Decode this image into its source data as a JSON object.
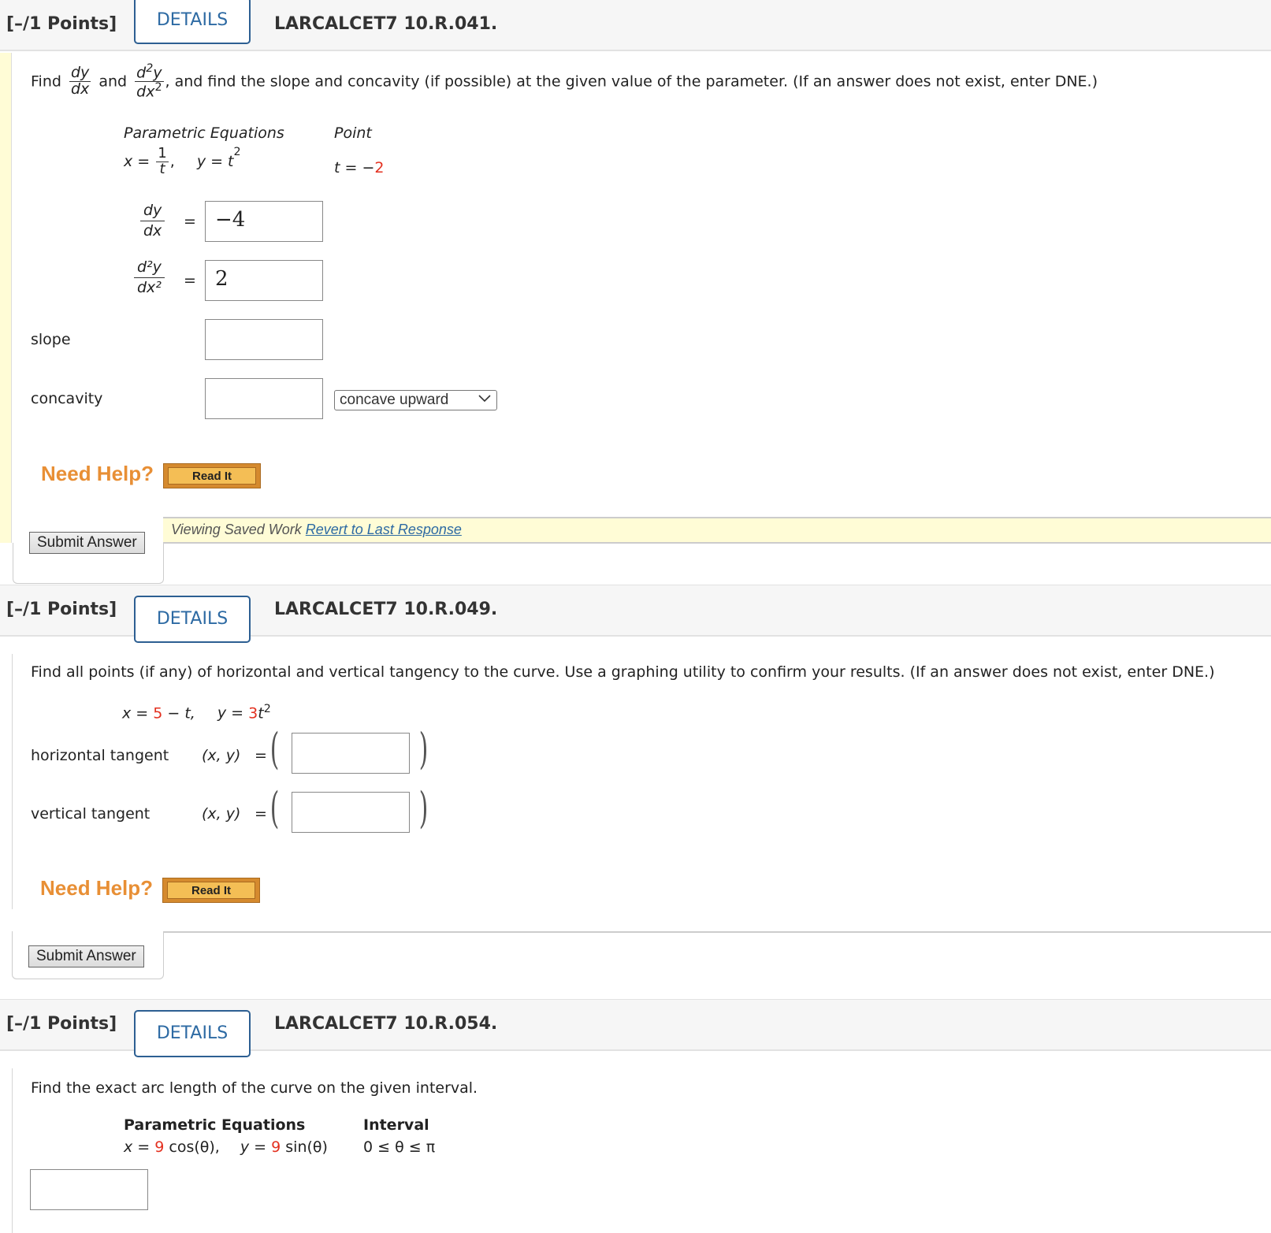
{
  "questions": [
    {
      "points": "[–/1 Points]",
      "details_label": "DETAILS",
      "code": "LARCALCET7 10.R.041.",
      "prompt": {
        "find": "Find",
        "dydx_num": "dy",
        "dydx_den": "dx",
        "and": "and",
        "d2y_num_d": "d",
        "d2y_num_exp": "2",
        "d2y_num_y": "y",
        "d2x_den": "dx",
        "d2x_den_exp": "2",
        "rest": ", and find the slope and concavity (if possible) at the given value of the parameter. (If an answer does not exist, enter DNE.)"
      },
      "equations_header": "Parametric Equations",
      "point_header": "Point",
      "x_eq_lhs": "x =",
      "x_eq_num": "1",
      "x_eq_den": "t",
      "y_eq": "y = t",
      "y_eq_exp": "2",
      "point_lhs": "t = −",
      "point_value": "2",
      "answers": {
        "dydx_label_num": "dy",
        "dydx_label_den": "dx",
        "dydx_value": "−4",
        "d2ydx2_label_num": "d²y",
        "d2ydx2_label_den": "dx²",
        "d2ydx2_value": "2",
        "equals": "=",
        "slope_label": "slope",
        "slope_value": "",
        "concavity_label": "concavity",
        "concavity_value": "",
        "concavity_select": "concave upward"
      },
      "need_help": "Need Help?",
      "read_it": "Read It",
      "submit": "Submit Answer",
      "saved_text": "Viewing Saved Work",
      "revert_link": "Revert to Last Response"
    },
    {
      "points": "[–/1 Points]",
      "details_label": "DETAILS",
      "code": "LARCALCET7 10.R.049.",
      "prompt": "Find all points (if any) of horizontal and vertical tangency to the curve. Use a graphing utility to confirm your results. (If an answer does not exist, enter DNE.)",
      "x_eq_lhs": "x = ",
      "x_eq_const": "5",
      "x_eq_rest": " − t,",
      "y_eq_lhs": "y = ",
      "y_eq_coef": "3",
      "y_eq_var": "t",
      "y_eq_exp": "2",
      "horizontal_label": "horizontal tangent",
      "vertical_label": "vertical tangent",
      "xy_label": "(x, y)",
      "equals": "=",
      "horizontal_value": "",
      "vertical_value": "",
      "need_help": "Need Help?",
      "read_it": "Read It",
      "submit": "Submit Answer"
    },
    {
      "points": "[–/1 Points]",
      "details_label": "DETAILS",
      "code": "LARCALCET7 10.R.054.",
      "prompt": "Find the exact arc length of the curve on the given interval.",
      "equations_header": "Parametric Equations",
      "interval_header": "Interval",
      "x_eq_lhs": "x = ",
      "x_eq_coef": "9",
      "x_eq_rest": " cos(θ),",
      "y_eq_lhs": "y = ",
      "y_eq_coef": "9",
      "y_eq_rest": " sin(θ)",
      "interval": "0 ≤ θ ≤ π",
      "answer_value": ""
    }
  ],
  "colors": {
    "accent_blue": "#2d6aa3",
    "red_param": "#e3301f",
    "need_help_orange": "#e88f35",
    "saved_bg": "#fffcd6"
  }
}
